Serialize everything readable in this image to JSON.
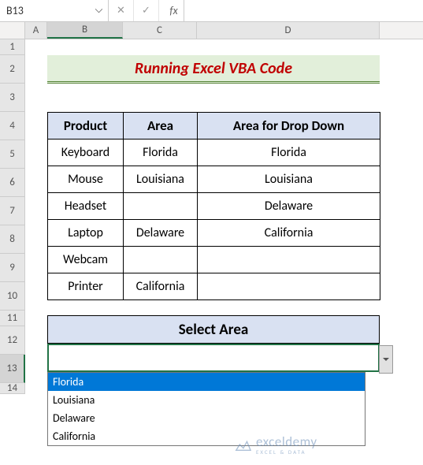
{
  "nameBox": {
    "value": "B13"
  },
  "formulaBar": {
    "cancel": "✕",
    "enter": "✓",
    "fx": "fx",
    "value": ""
  },
  "columns": [
    "A",
    "B",
    "C",
    "D"
  ],
  "rows": [
    "1",
    "2",
    "3",
    "4",
    "5",
    "6",
    "7",
    "8",
    "9",
    "10",
    "11",
    "12",
    "13",
    "14"
  ],
  "title": "Running Excel VBA Code",
  "table": {
    "headers": {
      "product": "Product",
      "area": "Area",
      "dd": "Area for Drop Down"
    },
    "rows": [
      {
        "product": "Keyboard",
        "area": "Florida",
        "dd": "Florida"
      },
      {
        "product": "Mouse",
        "area": "Louisiana",
        "dd": "Louisiana"
      },
      {
        "product": "Headset",
        "area": "",
        "dd": "Delaware"
      },
      {
        "product": "Laptop",
        "area": "Delaware",
        "dd": "California"
      },
      {
        "product": "Webcam",
        "area": "",
        "dd": ""
      },
      {
        "product": "Printer",
        "area": "California",
        "dd": ""
      }
    ]
  },
  "selectArea": {
    "label": "Select Area",
    "value": ""
  },
  "dropdown": {
    "items": [
      "Florida",
      "Louisiana",
      "Delaware",
      "California"
    ],
    "selectedIndex": 0
  },
  "watermark": {
    "brand": "exceldemy",
    "tag": "EXCEL & DATA"
  }
}
